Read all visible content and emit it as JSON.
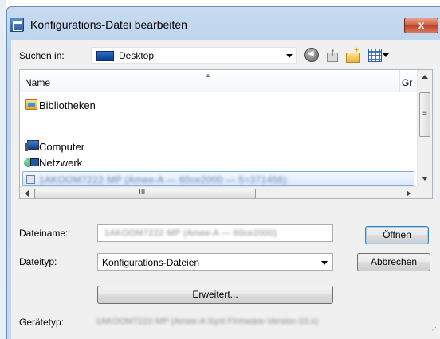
{
  "window": {
    "title": "Konfigurations-Datei bearbeiten",
    "close_label": "x"
  },
  "toolbar": {
    "lookin_label": "Suchen in:",
    "lookin_value": "Desktop",
    "icons": [
      "back-icon",
      "up-folder-icon",
      "new-folder-icon",
      "view-menu-icon"
    ]
  },
  "filelist": {
    "columns": [
      "Name",
      "Gr"
    ],
    "items": [
      {
        "label": "Bibliotheken",
        "icon": "libraries-icon"
      },
      {
        "label": "Computer",
        "icon": "computer-icon"
      },
      {
        "label": "Netzwerk",
        "icon": "network-icon"
      },
      {
        "label": "1AKOOM7222·MP (Amee-A — 60ce2000 — 5=371456)",
        "icon": "config-file-icon",
        "selected": true
      }
    ],
    "hscroll_grip": "III"
  },
  "form": {
    "filename_label": "Dateiname:",
    "filename_value": "1AKOOM7222·MP (Amee-A — 60ce2000)",
    "filetype_label": "Dateityp:",
    "filetype_value": "Konfigurations-Dateien",
    "open_label": "Öffnen",
    "cancel_label": "Abbrechen",
    "advanced_label": "Erweitert...",
    "devicetype_label": "Gerätetyp:",
    "devicetype_value": "1AKOOM7222·MP (Amee-A Synt Firmware-Version 03.x)"
  },
  "colors": {
    "title_gradient": "#c7daf0",
    "close_red": "#c34227",
    "selection_border": "#84acdd",
    "dialog_bg": "#f0f0f0"
  }
}
